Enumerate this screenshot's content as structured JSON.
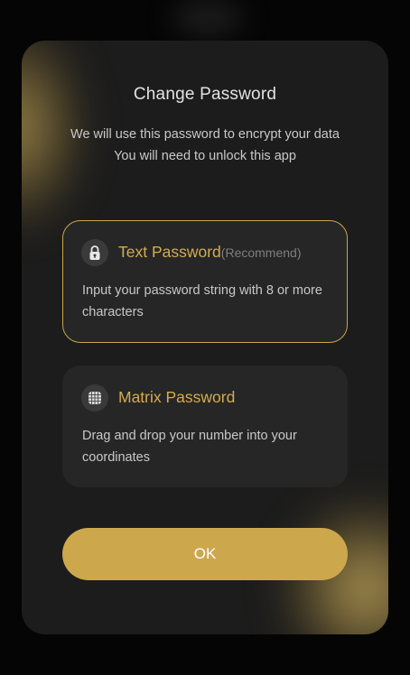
{
  "dialog": {
    "title": "Change Password",
    "subtitle_line1": "We will use this password to encrypt your data",
    "subtitle_line2": "You will need to unlock this app"
  },
  "options": [
    {
      "icon": "lock-icon",
      "title": "Text Password",
      "badge": "(Recommend)",
      "description": "Input your password string with 8 or more characters",
      "selected": true
    },
    {
      "icon": "grid-icon",
      "title": "Matrix Password",
      "badge": "",
      "description": "Drag and drop your number into your coordinates",
      "selected": false
    }
  ],
  "ok_button": {
    "label": "OK"
  },
  "colors": {
    "accent": "#cda74c",
    "card_background": "#262626",
    "modal_background": "#1c1c1c"
  }
}
